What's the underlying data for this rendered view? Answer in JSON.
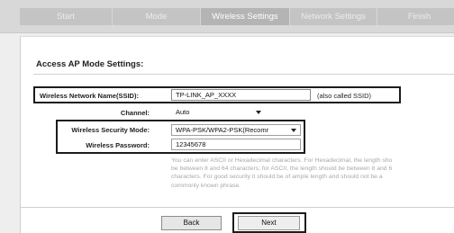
{
  "wizard": {
    "tabs": [
      {
        "label": "Start",
        "active": false
      },
      {
        "label": "Mode",
        "active": false
      },
      {
        "label": "Wireless Settings",
        "active": true
      },
      {
        "label": "Network Settings",
        "active": false
      },
      {
        "label": "Finish",
        "active": false
      }
    ]
  },
  "form": {
    "title": "Access AP Mode Settings:",
    "ssid": {
      "label": "Wireless Network Name(SSID):",
      "value": "TP-LINK_AP_XXXX",
      "suffix": "(also called SSID)"
    },
    "channel": {
      "label": "Channel:",
      "value": "Auto"
    },
    "security": {
      "label": "Wireless Security Mode:",
      "value": "WPA-PSK/WPA2-PSK(Recomr"
    },
    "password": {
      "label": "Wireless Password:",
      "value": "12345678"
    },
    "hint_lines": [
      "You can enter ASCII or Hexadecimal characters. For Hexadecimal, the length sho",
      "be between 8 and 64 characters; for ASCII, the length should be between 8 and 6",
      "characters. For good security it should be of ample length and should not be a",
      "commonly known phrase."
    ]
  },
  "buttons": {
    "back": "Back",
    "next": "Next"
  },
  "colors": {
    "tab_bar": "#c4c4c4",
    "tab_active": "#b4b4b4",
    "highlight_frame": "#1c1c1c",
    "hint_text": "#a8a8a8"
  }
}
